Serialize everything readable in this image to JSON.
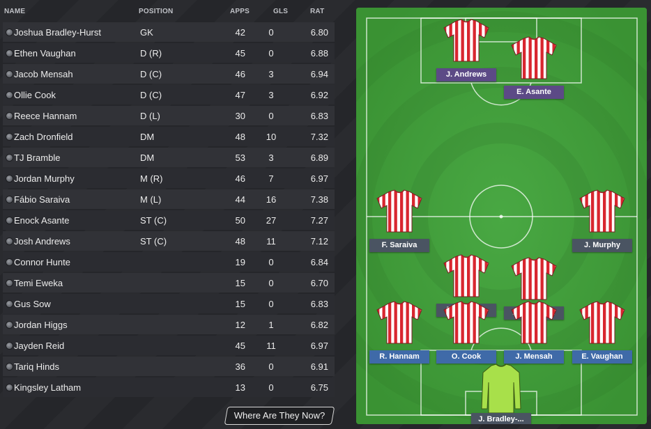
{
  "table": {
    "headers": {
      "name": "NAME",
      "position": "POSITION",
      "apps": "APPS",
      "gls": "GLS",
      "rat": "RAT"
    },
    "rows": [
      {
        "name": "Joshua Bradley-Hurst",
        "position": "GK",
        "apps": "42",
        "gls": "0",
        "rat": "6.80"
      },
      {
        "name": "Ethen Vaughan",
        "position": "D (R)",
        "apps": "45",
        "gls": "0",
        "rat": "6.88"
      },
      {
        "name": "Jacob Mensah",
        "position": "D (C)",
        "apps": "46",
        "gls": "3",
        "rat": "6.94"
      },
      {
        "name": "Ollie Cook",
        "position": "D (C)",
        "apps": "47",
        "gls": "3",
        "rat": "6.92"
      },
      {
        "name": "Reece Hannam",
        "position": "D (L)",
        "apps": "30",
        "gls": "0",
        "rat": "6.83"
      },
      {
        "name": "Zach Dronfield",
        "position": "DM",
        "apps": "48",
        "gls": "10",
        "rat": "7.32"
      },
      {
        "name": "TJ Bramble",
        "position": "DM",
        "apps": "53",
        "gls": "3",
        "rat": "6.89"
      },
      {
        "name": "Jordan Murphy",
        "position": "M (R)",
        "apps": "46",
        "gls": "7",
        "rat": "6.97"
      },
      {
        "name": "Fábio Saraiva",
        "position": "M (L)",
        "apps": "44",
        "gls": "16",
        "rat": "7.38"
      },
      {
        "name": "Enock Asante",
        "position": "ST (C)",
        "apps": "50",
        "gls": "27",
        "rat": "7.27"
      },
      {
        "name": "Josh Andrews",
        "position": "ST (C)",
        "apps": "48",
        "gls": "11",
        "rat": "7.12"
      },
      {
        "name": "Connor Hunte",
        "position": "",
        "apps": "19",
        "gls": "0",
        "rat": "6.84"
      },
      {
        "name": "Temi Eweka",
        "position": "",
        "apps": "15",
        "gls": "0",
        "rat": "6.70"
      },
      {
        "name": "Gus Sow",
        "position": "",
        "apps": "15",
        "gls": "0",
        "rat": "6.83"
      },
      {
        "name": "Jordan Higgs",
        "position": "",
        "apps": "12",
        "gls": "1",
        "rat": "6.82"
      },
      {
        "name": "Jayden Reid",
        "position": "",
        "apps": "45",
        "gls": "11",
        "rat": "6.97"
      },
      {
        "name": "Tariq Hinds",
        "position": "",
        "apps": "36",
        "gls": "0",
        "rat": "6.91"
      },
      {
        "name": "Kingsley Latham",
        "position": "",
        "apps": "13",
        "gls": "0",
        "rat": "6.75"
      }
    ]
  },
  "actions": {
    "where_are_they_now": "Where Are They Now?"
  },
  "pitch": {
    "players": [
      {
        "label": "J. Andrews",
        "role": "att"
      },
      {
        "label": "E. Asante",
        "role": "att"
      },
      {
        "label": "F. Saraiva",
        "role": "mid"
      },
      {
        "label": "J. Murphy",
        "role": "mid"
      },
      {
        "label": "T. Bramble",
        "role": "mid"
      },
      {
        "label": "Z. Dronfield",
        "role": "mid"
      },
      {
        "label": "R. Hannam",
        "role": "def"
      },
      {
        "label": "O. Cook",
        "role": "def"
      },
      {
        "label": "J. Mensah",
        "role": "def"
      },
      {
        "label": "E. Vaughan",
        "role": "def"
      },
      {
        "label": "J. Bradley-...",
        "role": "gk"
      }
    ]
  },
  "colors": {
    "background": "#26272b",
    "pitch_green": "#3f9b38",
    "shirt_red": "#d8262f",
    "shirt_white": "#ffffff",
    "gk_shirt": "#a8e04a",
    "defender_label": "#3f6aa8",
    "midfielder_label": "#4a5462",
    "attacker_label": "#5c4a86"
  },
  "icons": {
    "row_marker": "status-dot-icon",
    "kit": "striped-shirt-icon",
    "gk_kit": "goalkeeper-shirt-icon"
  }
}
